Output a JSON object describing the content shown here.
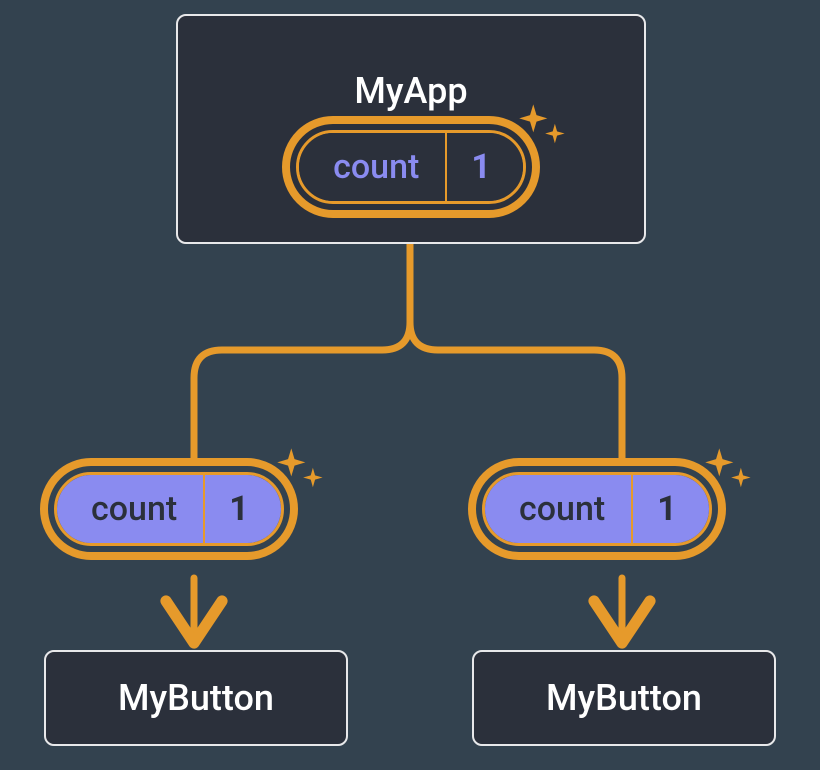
{
  "colors": {
    "background": "#33424f",
    "card_bg": "#2b303b",
    "card_border": "#e8e8ea",
    "accent": "#e69a2b",
    "purple": "#8a8bf0",
    "text_light": "#ffffff"
  },
  "parent": {
    "title": "MyApp",
    "state": {
      "label": "count",
      "value": "1"
    }
  },
  "props": {
    "left": {
      "label": "count",
      "value": "1"
    },
    "right": {
      "label": "count",
      "value": "1"
    }
  },
  "children": {
    "left": {
      "title": "MyButton"
    },
    "right": {
      "title": "MyButton"
    }
  }
}
